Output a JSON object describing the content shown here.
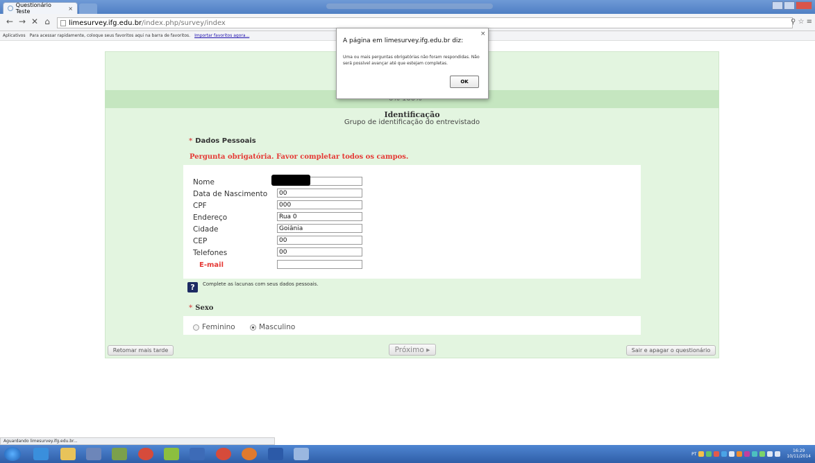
{
  "browser": {
    "tab_title": "Questionário Teste",
    "tab_close": "×",
    "url_host": "limesurvey.ifg.edu.br",
    "url_path": "/index.php/survey/index",
    "nav_back": "←",
    "nav_forward": "→",
    "nav_stop": "✕",
    "nav_home": "⌂",
    "right_icons": "⚲ ☆ ≡",
    "bookmarks_apps": "Aplicativos",
    "bookmarks_hint": "Para acessar rapidamente, coloque seus favoritos aqui na barra de favoritos.",
    "bookmarks_import": "Importar favoritos agora...",
    "status_text": "Aguardando limesurvey.ifg.edu.br..."
  },
  "survey": {
    "progress_text": "0%  100%",
    "progress_value": 0,
    "group_name": "Identificação",
    "group_description": "Grupo de identificação do entrevistado",
    "q1": {
      "title": "Dados Pessoais",
      "error": "Pergunta obrigatória. Favor completar todos os campos.",
      "fields": [
        {
          "label": "Nome",
          "value": ""
        },
        {
          "label": "Data de Nascimento",
          "value": "00"
        },
        {
          "label": "CPF",
          "value": "000"
        },
        {
          "label": "Endereço",
          "value": "Rua 0"
        },
        {
          "label": "Cidade",
          "value": "Goiânia"
        },
        {
          "label": "CEP",
          "value": "00"
        },
        {
          "label": "Telefones",
          "value": "00"
        },
        {
          "label": "E-mail",
          "value": ""
        }
      ],
      "help_icon": "?",
      "help": "Complete as lacunas com seus dados pessoais."
    },
    "q2": {
      "title": "Sexo",
      "options": [
        "Feminino",
        "Masculino"
      ],
      "selected": "Masculino"
    },
    "buttons": {
      "resume_later": "Retomar mais tarde",
      "next": "Próximo ▸",
      "exit_clear": "Sair e apagar o questionário"
    }
  },
  "dialog": {
    "title": "A página em limesurvey.ifg.edu.br diz:",
    "close": "×",
    "message": "Uma ou mais perguntas obrigatórias não foram respondidas. Não será possível avançar até que estejam completas.",
    "ok": "OK"
  },
  "taskbar": {
    "clock_time": "16:29",
    "clock_date": "10/11/2014",
    "lang": "PT"
  }
}
